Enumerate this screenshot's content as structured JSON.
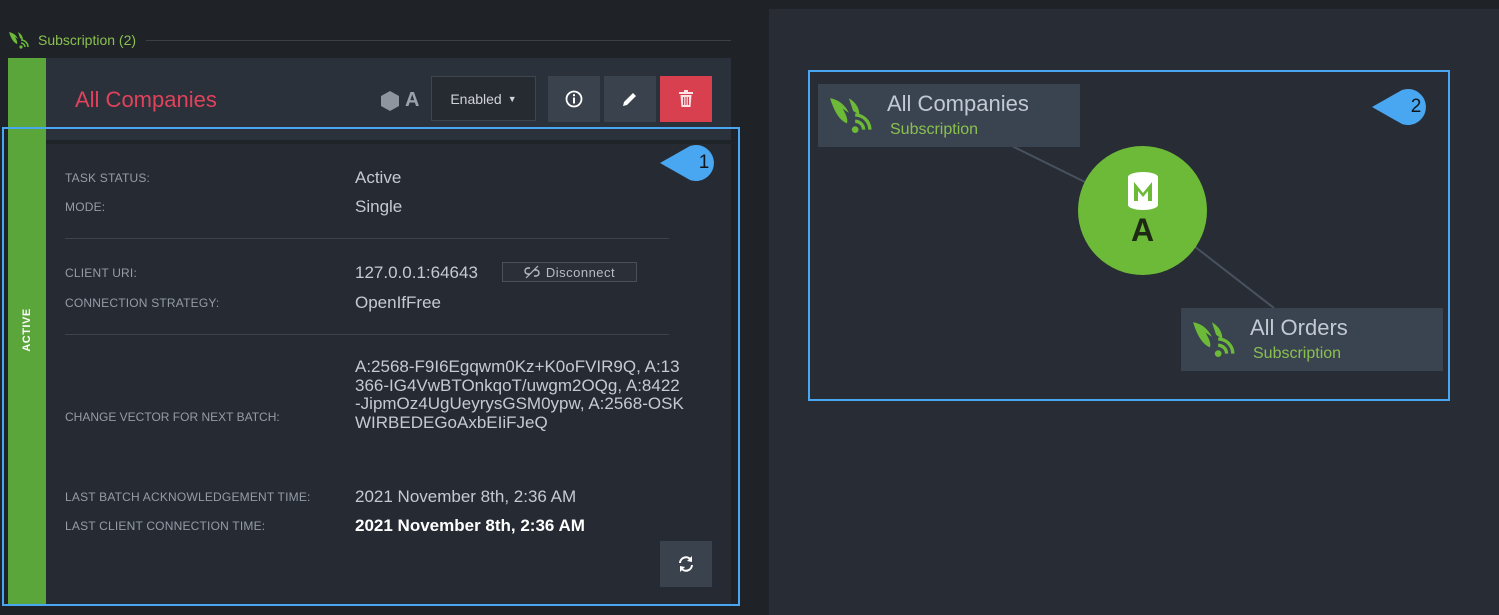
{
  "section": {
    "title": "Subscription (2)",
    "icon": "subscription-icon"
  },
  "task": {
    "name": "All Companies",
    "status_strip": "ACTIVE",
    "node_tag": "A",
    "state_dropdown": "Enabled",
    "buttons": {
      "info": "info-icon",
      "edit": "pencil-icon",
      "delete": "trash-icon",
      "refresh": "refresh-icon"
    },
    "details": {
      "task_status_label": "TASK STATUS:",
      "task_status_value": "Active",
      "mode_label": "MODE:",
      "mode_value": "Single",
      "client_uri_label": "CLIENT URI:",
      "client_uri_value": "127.0.0.1:64643",
      "disconnect_label": "Disconnect",
      "connection_strategy_label": "CONNECTION STRATEGY:",
      "connection_strategy_value": "OpenIfFree",
      "change_vector_label": "CHANGE VECTOR FOR NEXT BATCH:",
      "change_vector_value": "A:2568-F9I6Egqwm0Kz+K0oFVIR9Q, A:13366-IG4VwBTOnkqoT/uwgm2OQg, A:8422-JipmOz4UgUeyrysGSM0ypw, A:2568-OSKWIRBEDEGoAxbEIiFJeQ",
      "last_ack_label": "LAST BATCH ACKNOWLEDGEMENT TIME:",
      "last_ack_value": "2021 November 8th, 2:36 AM",
      "last_conn_label": "LAST CLIENT CONNECTION TIME:",
      "last_conn_value": "2021 November 8th, 2:36 AM"
    }
  },
  "graph": {
    "nodes": [
      {
        "name": "All Companies",
        "type": "Subscription"
      },
      {
        "name": "All Orders",
        "type": "Subscription"
      }
    ],
    "database": {
      "icon": "database-icon",
      "tag": "A"
    }
  },
  "callouts": [
    "1",
    "2"
  ],
  "colors": {
    "accent_green": "#6cba37",
    "task_name_red": "#e0425b",
    "callout_blue": "#49a7f1",
    "delete_red": "#d9404f"
  }
}
